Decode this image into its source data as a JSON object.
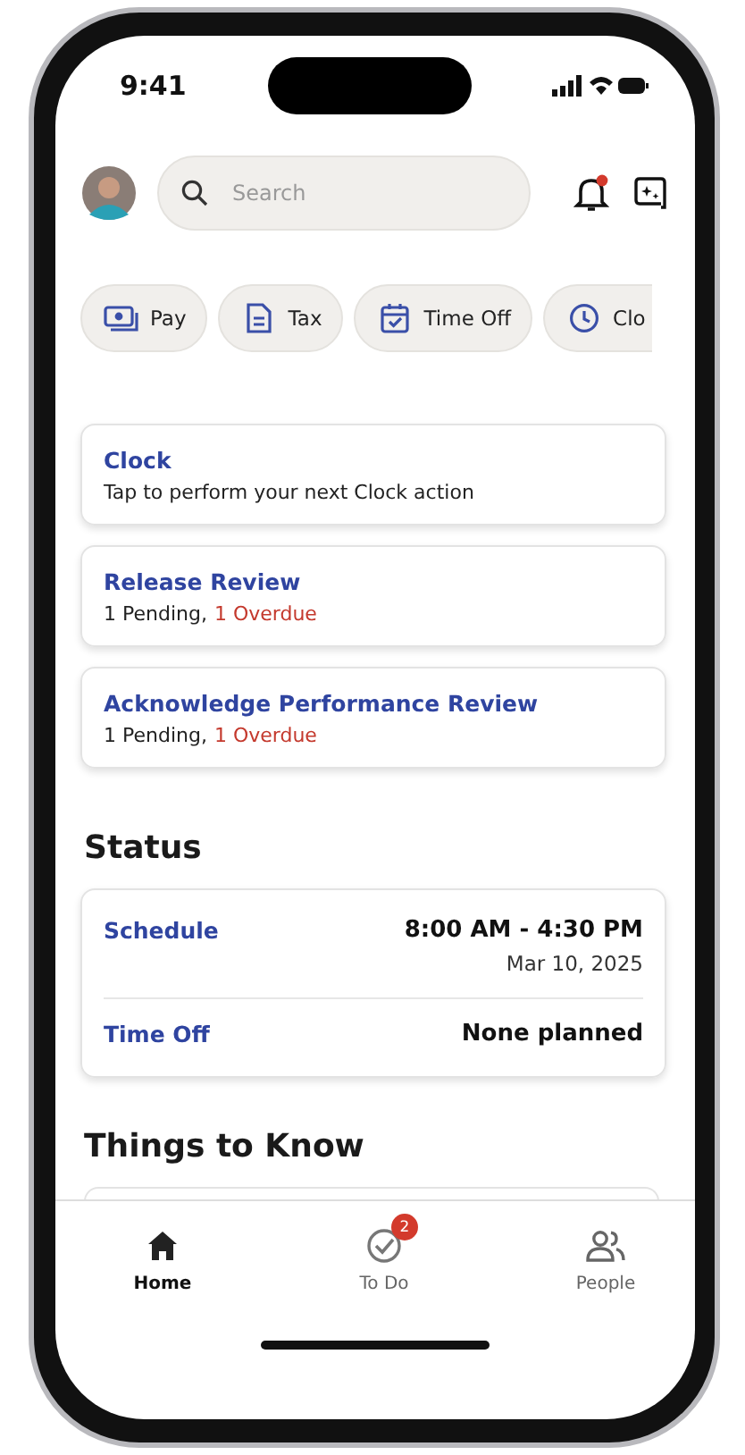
{
  "status_bar": {
    "time": "9:41"
  },
  "header": {
    "search": {
      "placeholder": "Search"
    },
    "notification_dot": true
  },
  "quick_actions": [
    {
      "kind": "pay",
      "label": "Pay"
    },
    {
      "kind": "tax",
      "label": "Tax"
    },
    {
      "kind": "timeoff",
      "label": "Time Off"
    },
    {
      "kind": "clock",
      "label": "Clo"
    }
  ],
  "cards": [
    {
      "kind": "text",
      "title": "Clock",
      "subtitle": "Tap to perform your next Clock action"
    },
    {
      "kind": "counts",
      "title": "Release Review",
      "pending": "1 Pending,",
      "overdue": "1 Overdue"
    },
    {
      "kind": "counts",
      "title": "Acknowledge Performance Review",
      "pending": "1 Pending,",
      "overdue": "1 Overdue"
    }
  ],
  "status": {
    "title": "Status",
    "rows": [
      {
        "label": "Schedule",
        "value": "8:00 AM - 4:30 PM",
        "detail": "Mar 10, 2025"
      },
      {
        "label": "Time Off",
        "value": "None planned"
      }
    ]
  },
  "things_to_know": {
    "title": "Things to Know"
  },
  "tab_bar": [
    {
      "kind": "home",
      "label": "Home",
      "selected": true
    },
    {
      "kind": "todo",
      "label": "To Do",
      "selected": false,
      "badge": "2"
    },
    {
      "kind": "people",
      "label": "People",
      "selected": false
    }
  ]
}
